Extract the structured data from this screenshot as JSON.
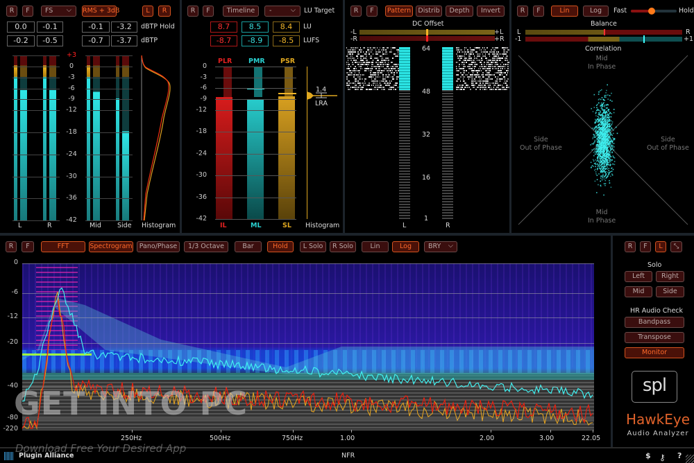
{
  "panel_levels": {
    "buttons": {
      "reset": "R",
      "freeze": "F",
      "scale": "FS",
      "rms": "RMS + 3dB",
      "left": "L",
      "right": "R"
    },
    "hold_row": {
      "values": [
        "0.0",
        "-0.1",
        "-0.1",
        "-3.2"
      ],
      "label": "dBTP Hold"
    },
    "dbtp_row": {
      "values": [
        "-0.2",
        "-0.5",
        "-0.7",
        "-3.7"
      ],
      "label": "dBTP"
    },
    "scale": [
      "+3",
      "0",
      "-3",
      "-6",
      "-9",
      "-12",
      "-18",
      "-24",
      "-30",
      "-36",
      "-42"
    ],
    "meter_labels": [
      "L",
      "R",
      "Mid",
      "Side",
      "Histogram"
    ],
    "meters": {
      "L": 0.88,
      "R": 0.88,
      "Mid": 0.88,
      "Side": 0.82
    }
  },
  "panel_loudness": {
    "buttons": {
      "reset": "R",
      "freeze": "F",
      "timeline": "Timeline",
      "target": "-",
      "target_label": "LU Target"
    },
    "lu_row": {
      "values": [
        "8.7",
        "8.5",
        "8.4"
      ],
      "label": "LU"
    },
    "lufs_row": {
      "values": [
        "-8.7",
        "-8.9",
        "-8.5"
      ],
      "label": "LUFS"
    },
    "top_labels": [
      "PLR",
      "PMR",
      "PSR"
    ],
    "bottom_labels": [
      "IL",
      "ML",
      "SL"
    ],
    "scale": [
      "0",
      "-3",
      "-6",
      "-9",
      "-12",
      "-18",
      "-24",
      "-30",
      "-36",
      "-42"
    ],
    "histogram_label": "Histogram",
    "lra_value": "1.4",
    "lra_label": "LRA",
    "colors": {
      "plr": "#d11a1a",
      "pmr": "#23c6c6",
      "psr": "#d9a21c"
    }
  },
  "panel_bits": {
    "buttons": {
      "reset": "R",
      "freeze": "F",
      "pattern": "Pattern",
      "distrib": "Distrib",
      "depth": "Depth",
      "invert": "Invert"
    },
    "dc_offset_label": "DC Offset",
    "dc_left": [
      "-L",
      "+L"
    ],
    "dc_right": [
      "-R",
      "+R"
    ],
    "scale": [
      "64",
      "48",
      "32",
      "16",
      "1"
    ],
    "channel_labels": [
      "L",
      "R"
    ]
  },
  "panel_stereo": {
    "buttons": {
      "reset": "R",
      "freeze": "F",
      "lin": "Lin",
      "log": "Log"
    },
    "speed_left": "Fast",
    "speed_right": "Hold",
    "speed_value": 0.45,
    "balance_label": "Balance",
    "balance_ends": [
      "L",
      "R"
    ],
    "correlation_ends": [
      "-1",
      "+1"
    ],
    "correlation_label": "Correlation",
    "mid_label": "Mid\nIn Phase",
    "side_label": "Side\nOut of Phase"
  },
  "panel_spectrum": {
    "buttons": {
      "reset": "R",
      "freeze": "F",
      "fft": "FFT",
      "spectrogram": "Spectrogram",
      "pano": "Pano/Phase",
      "octave": "1/3 Octave",
      "bar": "Bar",
      "hold": "Hold",
      "lsolo": "L Solo",
      "rsolo": "R Solo",
      "lin": "Lin",
      "log": "Log",
      "palette": "BRY"
    },
    "y_ticks": [
      "0",
      "-6",
      "-12",
      "-20",
      "-40",
      "-80",
      "-220"
    ],
    "x_ticks": [
      "250Hz",
      "500Hz",
      "750Hz",
      "1.00",
      "2.00",
      "3.00",
      "22.05"
    ]
  },
  "side_panel": {
    "buttons": {
      "reset": "R",
      "freeze": "F",
      "l": "L"
    },
    "solo_label": "Solo",
    "solo": [
      "Left",
      "Right",
      "Mid",
      "Side"
    ],
    "hr_label": "HR Audio Check",
    "hr": [
      "Bandpass",
      "Transpose",
      "Monitor"
    ],
    "logo": "spl",
    "product": "HawkEye",
    "subtitle": "Audio Analyzer"
  },
  "footer": {
    "brand": "Plugin Alliance",
    "nfr": "NFR",
    "icons": [
      "$",
      "?"
    ],
    "watermark_main": "GET INTO PC",
    "watermark_sub": "Download Free Your Desired App"
  }
}
